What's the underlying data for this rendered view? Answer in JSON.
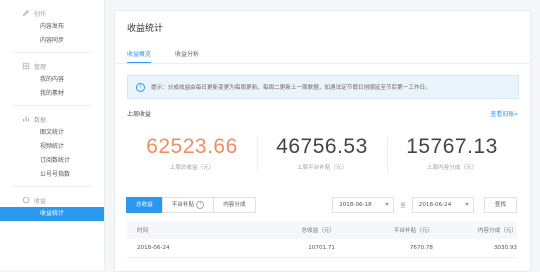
{
  "sidebar": {
    "sections": [
      {
        "title": "创作",
        "icon": "pencil-icon",
        "items": [
          {
            "label": "内容发布"
          },
          {
            "label": "内容同步"
          }
        ]
      },
      {
        "title": "管理",
        "icon": "list-icon",
        "items": [
          {
            "label": "我的内容"
          },
          {
            "label": "我的素材"
          }
        ]
      },
      {
        "title": "数据",
        "icon": "bar-chart-icon",
        "items": [
          {
            "label": "图文统计"
          },
          {
            "label": "视频统计"
          },
          {
            "label": "订阅数统计"
          },
          {
            "label": "公号号指数"
          }
        ]
      },
      {
        "title": "收益",
        "icon": "coin-icon",
        "items": [
          {
            "label": "收益统计"
          }
        ]
      }
    ]
  },
  "main": {
    "title": "收益统计",
    "tabs": [
      {
        "label": "收益概览"
      },
      {
        "label": "收益分析"
      }
    ],
    "notice": "提示：分成收益由每日更新变更为每周更新，每周二更新上一周数据，如遇法定节假日则顺延至节后第一工作日。",
    "section_title": "上周收益",
    "history_link": "查看旧账»",
    "stats": [
      {
        "value": "62523.66",
        "label": "上周总收益（元）"
      },
      {
        "value": "46756.53",
        "label": "上周平台补贴（元）"
      },
      {
        "value": "15767.13",
        "label": "上周内容分成（元）"
      }
    ],
    "filters": {
      "buttons": [
        "总收益",
        "平台补贴",
        "内容分成"
      ]
    },
    "date_range": {
      "start": "2018-06-18",
      "separator": "至",
      "end": "2018-06-24"
    },
    "query_button": "查找",
    "table": {
      "columns": [
        "时间",
        "总收益（元）",
        "平台补贴（元）",
        "内容分成（元）"
      ],
      "rows": [
        [
          "2018-06-24",
          "10701.71",
          "7670.78",
          "3030.93"
        ]
      ]
    }
  },
  "colors": {
    "accent": "#2b98f0",
    "highlight_number": "#ef8e62"
  }
}
